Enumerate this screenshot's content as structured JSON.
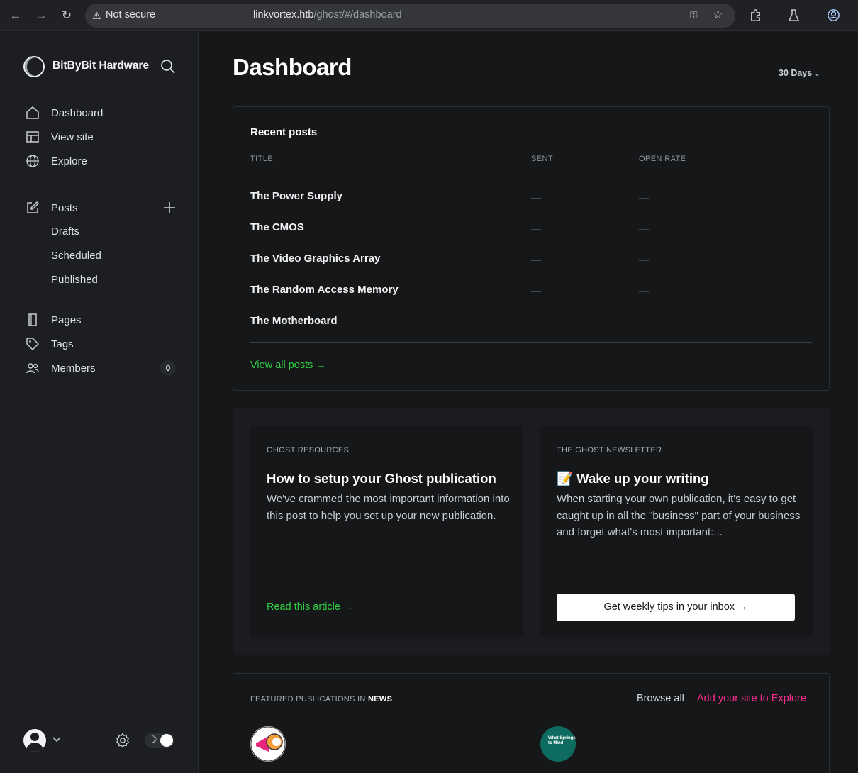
{
  "browser": {
    "security_label": "Not secure",
    "url_host": "linkvortex.htb",
    "url_path": "/ghost/#/dashboard"
  },
  "sidebar": {
    "brand_name": "BitByBit Hardware",
    "nav": [
      {
        "label": "Dashboard",
        "icon": "home-icon"
      },
      {
        "label": "View site",
        "icon": "layout-icon"
      },
      {
        "label": "Explore",
        "icon": "globe-icon"
      }
    ],
    "posts": {
      "label": "Posts",
      "icon": "pencil-icon",
      "sub_items": [
        "Drafts",
        "Scheduled",
        "Published"
      ]
    },
    "secondary": [
      {
        "label": "Pages",
        "icon": "page-icon"
      },
      {
        "label": "Tags",
        "icon": "tag-icon"
      },
      {
        "label": "Members",
        "icon": "members-icon",
        "count": "0"
      }
    ]
  },
  "main": {
    "title": "Dashboard",
    "range": "30 Days",
    "recent_posts": {
      "title": "Recent posts",
      "columns": [
        "TITLE",
        "SENT",
        "OPEN RATE"
      ],
      "rows": [
        "The Power Supply",
        "The CMOS",
        "The Video Graphics Array",
        "The Random Access Memory",
        "The Motherboard"
      ],
      "view_all": "View all posts →"
    },
    "resources": [
      {
        "kicker": "GHOST RESOURCES",
        "headline": "How to setup your Ghost publication",
        "excerpt": "We've crammed the most important information into this post to help you set up your new publication.",
        "link": "Read this article →"
      },
      {
        "kicker": "THE GHOST NEWSLETTER",
        "headline": "📝 Wake up your writing",
        "excerpt": "When starting your own publication, it's easy to get caught up in all the \"business\" part of your business and forget what's most important:...",
        "button": "Get weekly tips in your inbox →"
      }
    ],
    "featured": {
      "heading_prefix": "FEATURED PUBLICATIONS IN",
      "heading_topic": "NEWS",
      "browse_all": "Browse all",
      "add_site": "Add your site to Explore",
      "pub2_logo_text": "What Springs to Mind"
    }
  },
  "colors": {
    "accent_green": "#30cf43",
    "accent_pink": "#fb2d8d",
    "background": "#151719",
    "sidebar": "#1c1e21"
  }
}
